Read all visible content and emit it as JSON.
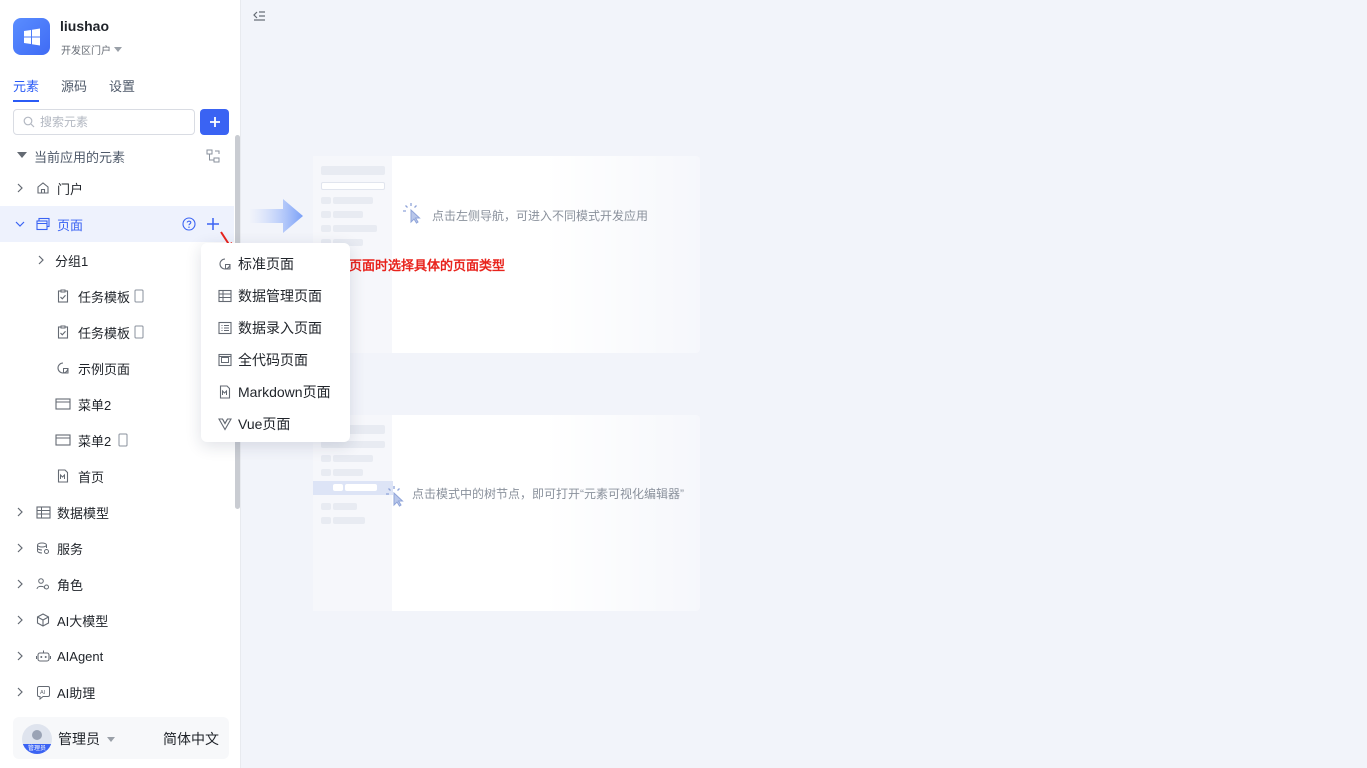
{
  "app": {
    "name": "liushao",
    "subtitle": "开发区门户"
  },
  "tabs": [
    {
      "label": "元素",
      "active": true
    },
    {
      "label": "源码",
      "active": false
    },
    {
      "label": "设置",
      "active": false
    }
  ],
  "search": {
    "placeholder": "搜索元素",
    "value": ""
  },
  "tree": {
    "section_label": "当前应用的元素",
    "items": {
      "portal": "门户",
      "page": "页面",
      "group1": "分组1",
      "task_template_1": "任务模板",
      "task_template_2": "任务模板",
      "example_page": "示例页面",
      "menu2_a": "菜单2",
      "menu2_b": "菜单2",
      "home": "首页",
      "data_model": "数据模型",
      "service": "服务",
      "role": "角色",
      "ai_model": "AI大模型",
      "ai_agent": "AIAgent",
      "ai_assistant": "AI助理"
    }
  },
  "footer": {
    "user": "管理员",
    "avatar_tag": "管理员",
    "language": "简体中文"
  },
  "popup_menu": {
    "items": [
      {
        "label": "标准页面",
        "icon": "standard-page-icon"
      },
      {
        "label": "数据管理页面",
        "icon": "table-icon"
      },
      {
        "label": "数据录入页面",
        "icon": "form-list-icon"
      },
      {
        "label": "全代码页面",
        "icon": "code-icon"
      },
      {
        "label": "Markdown页面",
        "icon": "markdown-icon"
      },
      {
        "label": "Vue页面",
        "icon": "vue-icon"
      }
    ]
  },
  "annotation": "创建页面时选择具体的页面类型",
  "hints": {
    "nav_hint": "点击左侧导航，可进入不同模式开发应用",
    "tree_hint": "点击模式中的树节点，即可打开“元素可视化编辑器”"
  },
  "colors": {
    "accent": "#3a63f3",
    "annotation": "#e8231c"
  }
}
